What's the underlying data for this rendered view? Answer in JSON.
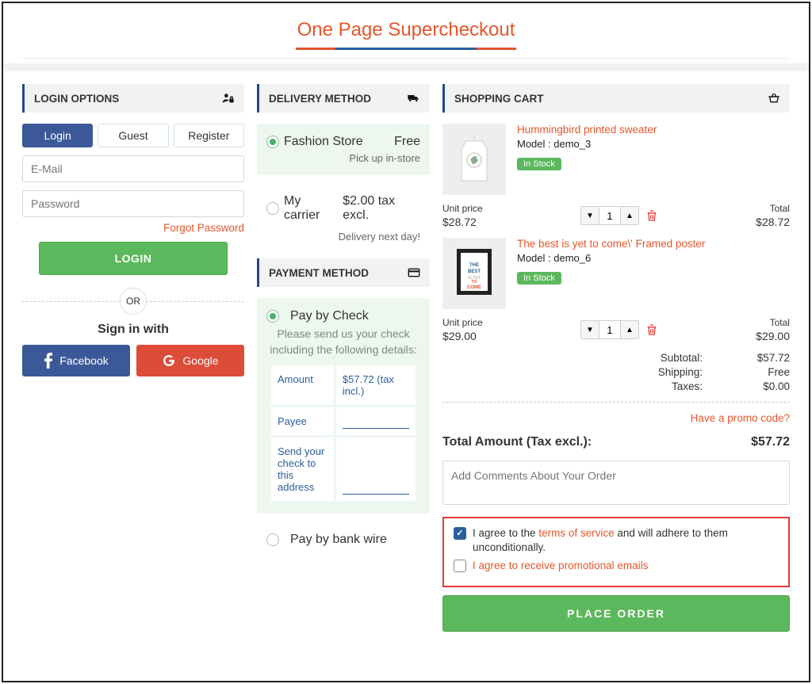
{
  "title": "One Page Supercheckout",
  "login": {
    "heading": "LOGIN OPTIONS",
    "tabs": [
      "Login",
      "Guest",
      "Register"
    ],
    "email_placeholder": "E-Mail",
    "password_placeholder": "Password",
    "forgot": "Forgot Password",
    "login_btn": "LOGIN",
    "or": "OR",
    "signin_with": "Sign in with",
    "facebook": "Facebook",
    "google": "Google"
  },
  "delivery": {
    "heading": "DELIVERY METHOD",
    "options": [
      {
        "label": "Fashion Store",
        "price": "Free",
        "note": "Pick up in-store"
      },
      {
        "label": "My carrier",
        "price": "$2.00 tax excl.",
        "note": "Delivery next day!"
      }
    ]
  },
  "payment": {
    "heading": "PAYMENT METHOD",
    "options": [
      {
        "label": "Pay by Check",
        "note": "Please send us your check including the following details:"
      },
      {
        "label": "Pay by bank wire"
      }
    ],
    "table": [
      {
        "k": "Amount",
        "v": "$57.72 (tax incl.)"
      },
      {
        "k": "Payee",
        "v": ""
      },
      {
        "k": "Send your check to this address",
        "v": ""
      }
    ]
  },
  "cart": {
    "heading": "SHOPPING CART",
    "items": [
      {
        "name": "Hummingbird printed sweater",
        "model": "Model : demo_3",
        "stock": "In Stock",
        "unit_label": "Unit price",
        "unit": "$28.72",
        "qty": "1",
        "total_label": "Total",
        "total": "$28.72"
      },
      {
        "name": "The best is yet to come\\' Framed poster",
        "model": "Model : demo_6",
        "stock": "In Stock",
        "unit_label": "Unit price",
        "unit": "$29.00",
        "qty": "1",
        "total_label": "Total",
        "total": "$29.00"
      }
    ],
    "subtotal_label": "Subtotal:",
    "subtotal": "$57.72",
    "shipping_label": "Shipping:",
    "shipping": "Free",
    "taxes_label": "Taxes:",
    "taxes": "$0.00",
    "promo": "Have a promo code?",
    "grand_label": "Total Amount (Tax excl.):",
    "grand": "$57.72",
    "comment_placeholder": "Add Comments About Your Order",
    "agree_pre": "I agree to the ",
    "agree_link": "terms of service",
    "agree_post": " and will adhere to them unconditionally.",
    "promo_emails": "I agree to receive promotional emails",
    "place": "PLACE ORDER"
  }
}
